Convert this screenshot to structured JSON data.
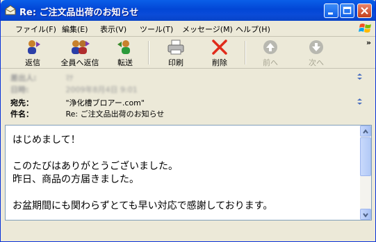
{
  "window": {
    "title": "Re: ご注文品出荷のお知らせ"
  },
  "menu": {
    "items": [
      "ファイル(F)",
      "編集(E)",
      "表示(V)",
      "ツール(T)",
      "メッセージ(M)",
      "ヘルプ(H)"
    ]
  },
  "toolbar": {
    "reply": "返信",
    "reply_all": "全員へ返信",
    "forward": "転送",
    "print": "印刷",
    "delete": "削除",
    "prev": "前へ",
    "next": "次へ",
    "more": "»"
  },
  "header": {
    "from_label": "差出人:",
    "from_value": "ﾏﾅ",
    "date_label": "日時:",
    "date_value": "2009年8月4日 9:01",
    "to_label": "宛先：",
    "to_value": "\"浄化槽ブロアー.com\"",
    "subject_label": "件名：",
    "subject_value": "Re: ご注文品出荷のお知らせ"
  },
  "message": {
    "lines": "はじめまして！\n\nこのたびはありがとうございました。\n昨日、商品の方届きました。\n\nお盆期間にも関わらずとても早い対応で感謝しております。"
  },
  "colors": {
    "titlebar": "#0246d6",
    "chrome": "#ece9d8",
    "close_button": "#c4401c"
  }
}
